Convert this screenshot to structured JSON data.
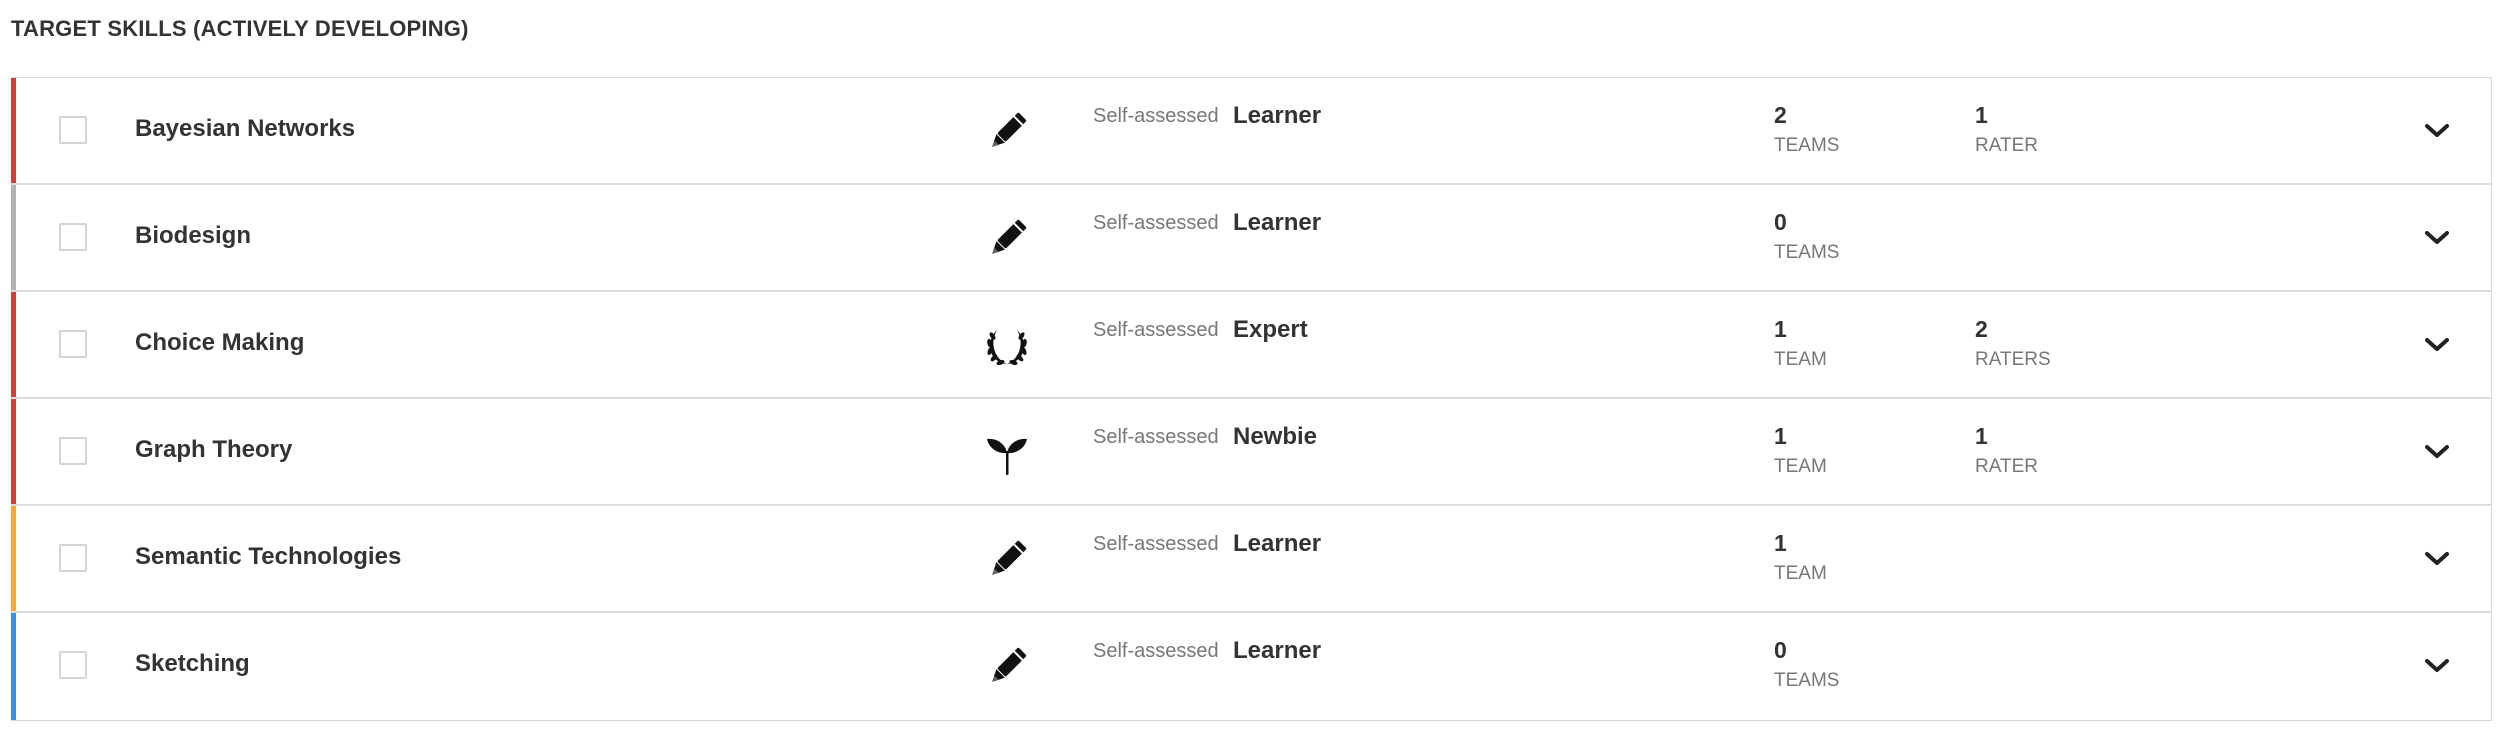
{
  "section": {
    "title": "TARGET SKILLS (ACTIVELY DEVELOPING)"
  },
  "colors": {
    "red_accent": "#c9423a",
    "gray_accent": "#b3b3b3",
    "orange_accent": "#f0a93e",
    "blue_accent": "#3d8fdc"
  },
  "skills": [
    {
      "name": "Bayesian Networks",
      "accent_color": "#c9423a",
      "icon": "pencil-icon",
      "assessed_label": "Self-assessed",
      "level": "Learner",
      "teams_count": "2",
      "teams_label": "TEAMS",
      "raters_count": "1",
      "raters_label": "RATER"
    },
    {
      "name": "Biodesign",
      "accent_color": "#b3b3b3",
      "icon": "pencil-icon",
      "assessed_label": "Self-assessed",
      "level": "Learner",
      "teams_count": "0",
      "teams_label": "TEAMS",
      "raters_count": "",
      "raters_label": ""
    },
    {
      "name": "Choice Making",
      "accent_color": "#c9423a",
      "icon": "laurel-wreath-icon",
      "assessed_label": "Self-assessed",
      "level": "Expert",
      "teams_count": "1",
      "teams_label": "TEAM",
      "raters_count": "2",
      "raters_label": "RATERS"
    },
    {
      "name": "Graph Theory",
      "accent_color": "#c9423a",
      "icon": "sprout-icon",
      "assessed_label": "Self-assessed",
      "level": "Newbie",
      "teams_count": "1",
      "teams_label": "TEAM",
      "raters_count": "1",
      "raters_label": "RATER"
    },
    {
      "name": "Semantic Technologies",
      "accent_color": "#f0a93e",
      "icon": "pencil-icon",
      "assessed_label": "Self-assessed",
      "level": "Learner",
      "teams_count": "1",
      "teams_label": "TEAM",
      "raters_count": "",
      "raters_label": ""
    },
    {
      "name": "Sketching",
      "accent_color": "#3d8fdc",
      "icon": "pencil-icon",
      "assessed_label": "Self-assessed",
      "level": "Learner",
      "teams_count": "0",
      "teams_label": "TEAMS",
      "raters_count": "",
      "raters_label": ""
    }
  ]
}
